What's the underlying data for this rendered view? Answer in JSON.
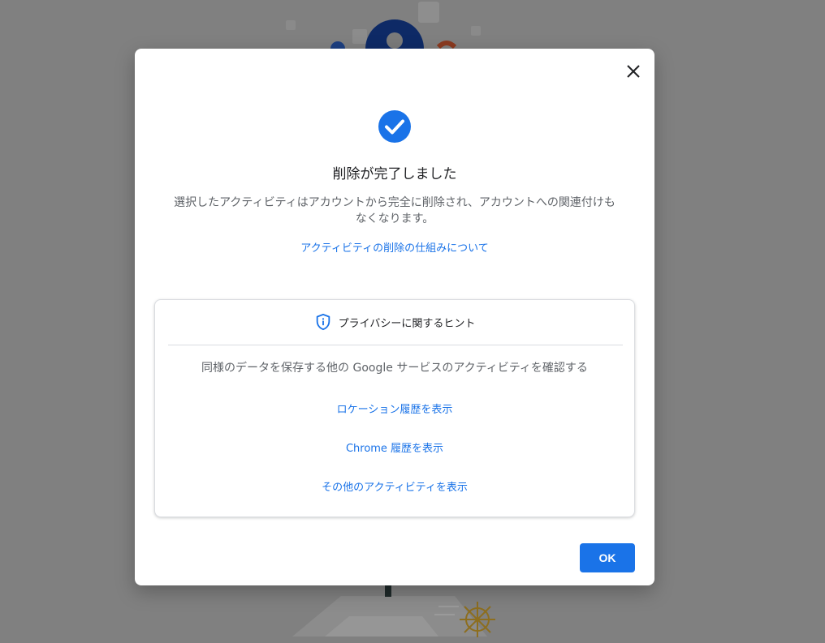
{
  "background": {
    "overlay_color": "#808080"
  },
  "dialog": {
    "close_icon": "close-icon",
    "status_icon": "check-circle-icon",
    "accent_color": "#1a73e8",
    "title": "削除が完了しました",
    "description": "選択したアクティビティはアカウントから完全に削除され、アカウントへの関連付けもなくなります。",
    "learn_link": "アクティビティの削除の仕組みについて",
    "privacy_card": {
      "icon": "shield-info-icon",
      "header": "プライバシーに関するヒント",
      "description": "同様のデータを保存する他の Google サービスのアクティビティを確認する",
      "links": [
        "ロケーション履歴を表示",
        "Chrome 履歴を表示",
        "その他のアクティビティを表示"
      ]
    },
    "ok_label": "OK"
  }
}
